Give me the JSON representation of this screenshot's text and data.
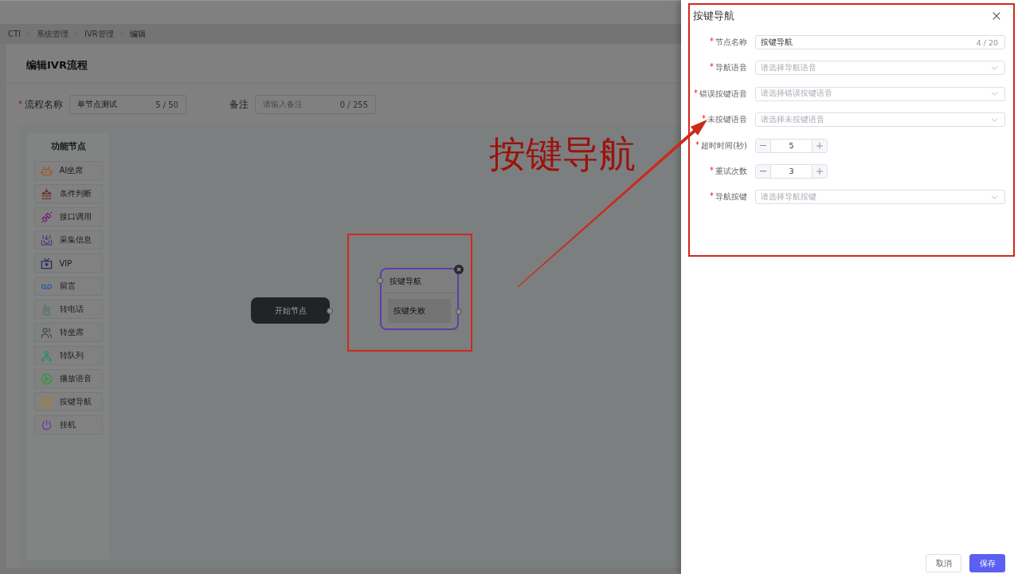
{
  "breadcrumb": [
    "CTI",
    "系统管理",
    "IVR管理",
    "编辑"
  ],
  "page_title": "编辑IVR流程",
  "flow_form": {
    "name": {
      "label": "流程名称",
      "required": true,
      "value": "单节点测试",
      "count": "5 / 50"
    },
    "remark": {
      "label": "备注",
      "placeholder": "请输入备注",
      "count": "0 / 255"
    }
  },
  "node_palette": {
    "title": "功能节点",
    "items": [
      "AI坐席",
      "条件判断",
      "接口调用",
      "采集信息",
      "VIP",
      "留言",
      "转电话",
      "转坐席",
      "转队列",
      "播放语音",
      "按键导航",
      "挂机"
    ]
  },
  "canvas": {
    "nodes": [
      {
        "kind": "start",
        "label": "开始节点",
        "selected": false
      },
      {
        "kind": "menu",
        "label": "按键导航",
        "selected": true,
        "branches": [
          "按键失败"
        ]
      }
    ]
  },
  "annotation": {
    "text": "按键导航"
  },
  "drawer": {
    "title": "按键导航",
    "fields": [
      {
        "kind": "text",
        "label": "节点名称",
        "required": true,
        "value": "按键导航",
        "count": "4 / 20"
      },
      {
        "kind": "select",
        "label": "导航语音",
        "required": true,
        "placeholder": "请选择导航语音"
      },
      {
        "kind": "select",
        "label": "错误按键语音",
        "required": true,
        "placeholder": "请选择错误按键语音"
      },
      {
        "kind": "select",
        "label": "未按键语音",
        "required": true,
        "placeholder": "请选择未按键语音"
      },
      {
        "kind": "number",
        "label": "超时时间(秒)",
        "required": true,
        "value": "5"
      },
      {
        "kind": "number",
        "label": "重试次数",
        "required": true,
        "value": "3"
      },
      {
        "kind": "select",
        "label": "导航按键",
        "required": true,
        "placeholder": "请选择导航按键"
      }
    ],
    "buttons": [
      {
        "kind": "default",
        "label": "取消"
      },
      {
        "kind": "primary",
        "label": "保存"
      }
    ]
  }
}
